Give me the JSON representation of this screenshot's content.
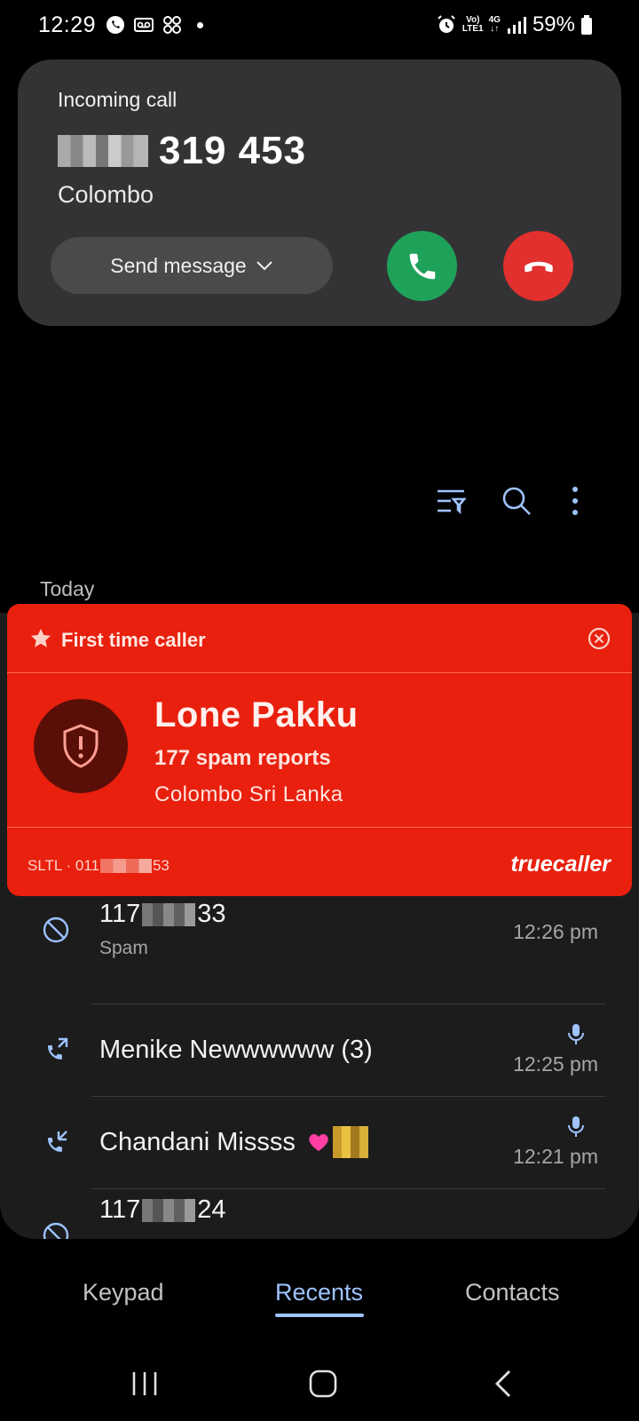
{
  "status_bar": {
    "time": "12:29",
    "network_top": "Vo)",
    "network_bottom": "LTE1",
    "net_4g": "4G",
    "battery": "59%"
  },
  "incoming_call": {
    "label": "Incoming call",
    "number_visible": "319 453",
    "location": "Colombo",
    "send_message_label": "Send message",
    "accept_color": "#1ea25a",
    "decline_color": "#e1302e"
  },
  "section_header": "Today",
  "truecaller": {
    "header": "First time caller",
    "name": "Lone Pakku",
    "reports": "177 spam reports",
    "location": "Colombo Sri Lanka",
    "carrier_prefix": "SLTL · 011",
    "carrier_suffix": "53",
    "brand": "truecaller",
    "bg_color": "#e8200d"
  },
  "recents": [
    {
      "name_prefix": "117",
      "name_suffix": "33",
      "sub": "Spam",
      "time": "12:26 pm",
      "icon": "blocked-icon"
    },
    {
      "name": "Menike Newwwwww (3)",
      "time": "12:25 pm",
      "icon": "outgoing-call-icon",
      "has_recording": true
    },
    {
      "name": "Chandani Missss",
      "time": "12:21 pm",
      "icon": "incoming-call-icon",
      "has_recording": true
    },
    {
      "name_prefix": "117",
      "name_suffix": "24",
      "icon": "blocked-icon"
    }
  ],
  "tabs": {
    "keypad": "Keypad",
    "recents": "Recents",
    "contacts": "Contacts"
  }
}
